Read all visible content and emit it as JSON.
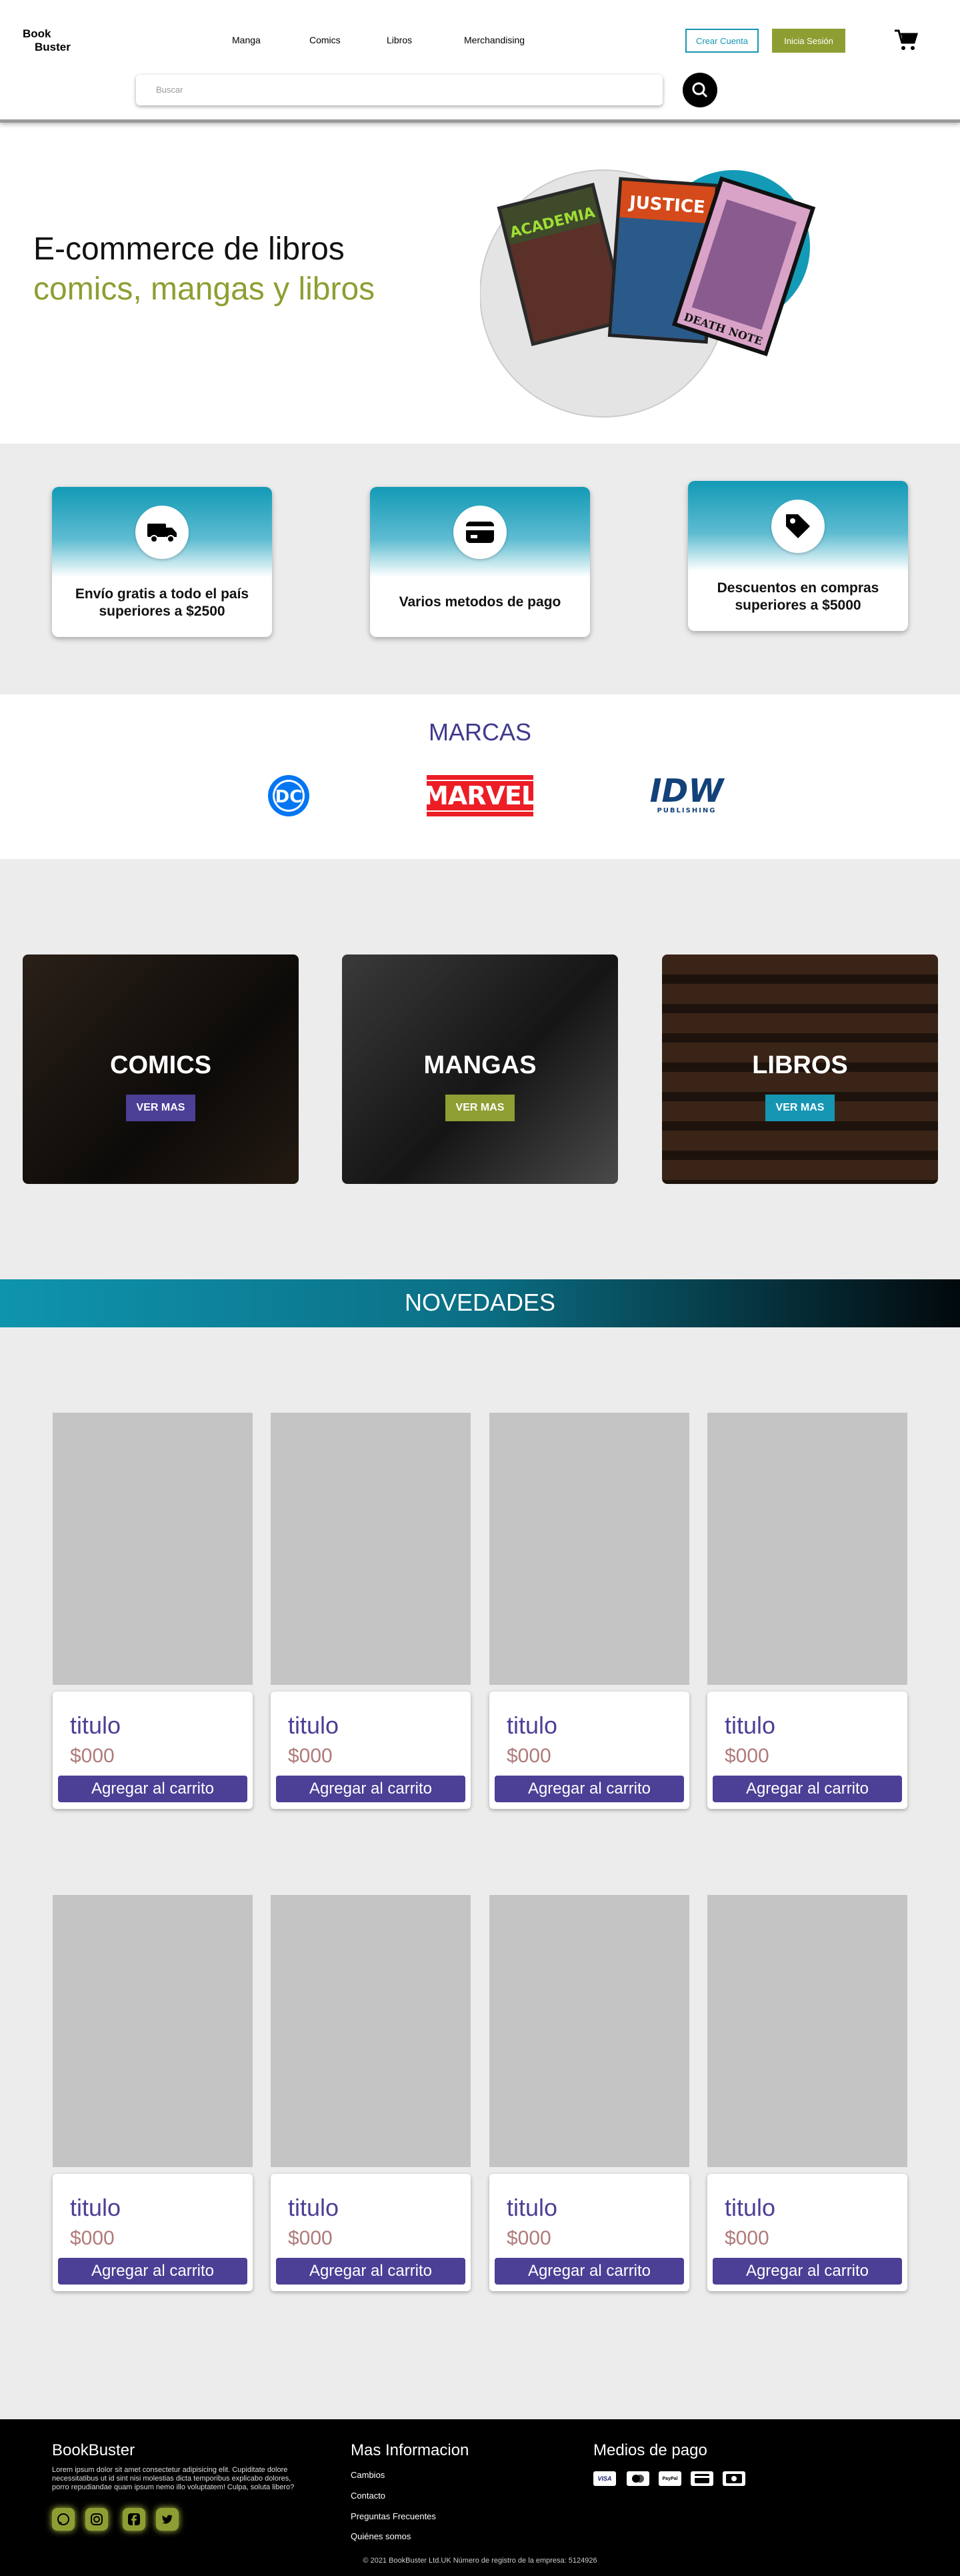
{
  "header": {
    "logo_line1": "Book",
    "logo_line2": "Buster",
    "nav": [
      "Manga",
      "Comics",
      "Libros",
      "Merchandising"
    ],
    "create_account": "Crear Cuenta",
    "login": "Inicia Sesión",
    "search_placeholder": "Buscar"
  },
  "hero": {
    "line1": "E-commerce de libros",
    "line2": "comics, mangas y libros",
    "covers": [
      "ACADEMIA",
      "JUSTICE",
      "DEATH NOTE"
    ]
  },
  "features": [
    {
      "icon": "truck-icon",
      "text": "Envío gratis a todo el país superiores a $2500"
    },
    {
      "icon": "credit-card-icon",
      "text": "Varios metodos de pago"
    },
    {
      "icon": "price-tag-icon",
      "text": "Descuentos en compras superiores a $5000"
    }
  ],
  "brands": {
    "title": "MARCAS",
    "items": [
      "DC",
      "MARVEL",
      "IDW",
      "PUBLISHING"
    ]
  },
  "categories": [
    {
      "name": "COMICS",
      "button": "VER MAS",
      "color": "#4b3f96"
    },
    {
      "name": "MANGAS",
      "button": "VER MAS",
      "color": "#8f9e32"
    },
    {
      "name": "LIBROS",
      "button": "VER MAS",
      "color": "#1695b3"
    }
  ],
  "novedades": {
    "title": "NOVEDADES",
    "products": [
      {
        "title": "titulo",
        "price": "$000",
        "button": "Agregar al carrito"
      },
      {
        "title": "titulo",
        "price": "$000",
        "button": "Agregar al carrito"
      },
      {
        "title": "titulo",
        "price": "$000",
        "button": "Agregar al carrito"
      },
      {
        "title": "titulo",
        "price": "$000",
        "button": "Agregar al carrito"
      },
      {
        "title": "titulo",
        "price": "$000",
        "button": "Agregar al carrito"
      },
      {
        "title": "titulo",
        "price": "$000",
        "button": "Agregar al carrito"
      },
      {
        "title": "titulo",
        "price": "$000",
        "button": "Agregar al carrito"
      },
      {
        "title": "titulo",
        "price": "$000",
        "button": "Agregar al carrito"
      }
    ]
  },
  "footer": {
    "brand": "BookBuster",
    "lorem": "Lorem ipsum dolor sit amet consectetur adipisicing elit. Cupiditate dolore necessitatibus ut id sint nisi molestias dicta temporibus explicabo dolores, porro repudiandae quam ipsum nemo illo voluptatem! Culpa, soluta libero?",
    "social": [
      "whatsapp-icon",
      "instagram-icon",
      "facebook-icon",
      "twitter-icon"
    ],
    "info_title": "Mas Informacion",
    "links": [
      "Cambios",
      "Contacto",
      "Preguntas Frecuentes",
      "Quiénes somos"
    ],
    "payments_title": "Medios de pago",
    "payments": [
      "VISA",
      "mastercard-icon",
      "PayPal",
      "card-icon",
      "cash-icon"
    ],
    "copyright": "© 2021 BookBuster Ltd.UK Número de registro de la empresa: 5124926"
  }
}
